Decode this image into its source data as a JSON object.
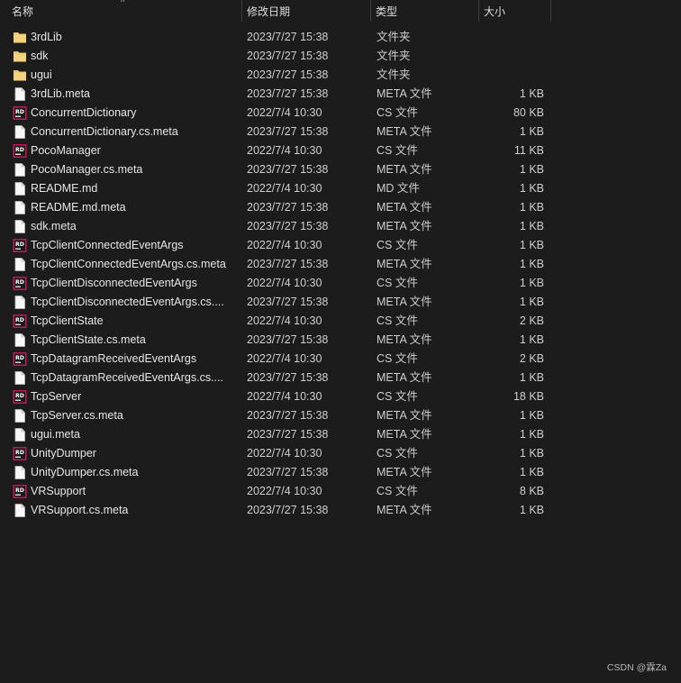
{
  "header": {
    "name": "名称",
    "date": "修改日期",
    "type": "类型",
    "size": "大小"
  },
  "colors": {
    "background": "#1c1c1c",
    "folder": "#e9c46a",
    "rider_icon_bg": "#1a1a1a",
    "rider_icon_border": "#c2185b"
  },
  "files": [
    {
      "icon": "folder-icon",
      "name": "3rdLib",
      "date": "2023/7/27 15:38",
      "type": "文件夹",
      "size": ""
    },
    {
      "icon": "folder-icon",
      "name": "sdk",
      "date": "2023/7/27 15:38",
      "type": "文件夹",
      "size": ""
    },
    {
      "icon": "folder-icon",
      "name": "ugui",
      "date": "2023/7/27 15:38",
      "type": "文件夹",
      "size": ""
    },
    {
      "icon": "file-icon",
      "name": "3rdLib.meta",
      "date": "2023/7/27 15:38",
      "type": "META 文件",
      "size": "1 KB"
    },
    {
      "icon": "rider-cs-icon",
      "name": "ConcurrentDictionary",
      "date": "2022/7/4 10:30",
      "type": "CS 文件",
      "size": "80 KB"
    },
    {
      "icon": "file-icon",
      "name": "ConcurrentDictionary.cs.meta",
      "date": "2023/7/27 15:38",
      "type": "META 文件",
      "size": "1 KB"
    },
    {
      "icon": "rider-cs-icon",
      "name": "PocoManager",
      "date": "2022/7/4 10:30",
      "type": "CS 文件",
      "size": "11 KB"
    },
    {
      "icon": "file-icon",
      "name": "PocoManager.cs.meta",
      "date": "2023/7/27 15:38",
      "type": "META 文件",
      "size": "1 KB"
    },
    {
      "icon": "file-icon",
      "name": "README.md",
      "date": "2022/7/4 10:30",
      "type": "MD 文件",
      "size": "1 KB"
    },
    {
      "icon": "file-icon",
      "name": "README.md.meta",
      "date": "2023/7/27 15:38",
      "type": "META 文件",
      "size": "1 KB"
    },
    {
      "icon": "file-icon",
      "name": "sdk.meta",
      "date": "2023/7/27 15:38",
      "type": "META 文件",
      "size": "1 KB"
    },
    {
      "icon": "rider-cs-icon",
      "name": "TcpClientConnectedEventArgs",
      "date": "2022/7/4 10:30",
      "type": "CS 文件",
      "size": "1 KB"
    },
    {
      "icon": "file-icon",
      "name": "TcpClientConnectedEventArgs.cs.meta",
      "date": "2023/7/27 15:38",
      "type": "META 文件",
      "size": "1 KB"
    },
    {
      "icon": "rider-cs-icon",
      "name": "TcpClientDisconnectedEventArgs",
      "date": "2022/7/4 10:30",
      "type": "CS 文件",
      "size": "1 KB"
    },
    {
      "icon": "file-icon",
      "name": "TcpClientDisconnectedEventArgs.cs....",
      "date": "2023/7/27 15:38",
      "type": "META 文件",
      "size": "1 KB"
    },
    {
      "icon": "rider-cs-icon",
      "name": "TcpClientState",
      "date": "2022/7/4 10:30",
      "type": "CS 文件",
      "size": "2 KB"
    },
    {
      "icon": "file-icon",
      "name": "TcpClientState.cs.meta",
      "date": "2023/7/27 15:38",
      "type": "META 文件",
      "size": "1 KB"
    },
    {
      "icon": "rider-cs-icon",
      "name": "TcpDatagramReceivedEventArgs",
      "date": "2022/7/4 10:30",
      "type": "CS 文件",
      "size": "2 KB"
    },
    {
      "icon": "file-icon",
      "name": "TcpDatagramReceivedEventArgs.cs....",
      "date": "2023/7/27 15:38",
      "type": "META 文件",
      "size": "1 KB"
    },
    {
      "icon": "rider-cs-icon",
      "name": "TcpServer",
      "date": "2022/7/4 10:30",
      "type": "CS 文件",
      "size": "18 KB"
    },
    {
      "icon": "file-icon",
      "name": "TcpServer.cs.meta",
      "date": "2023/7/27 15:38",
      "type": "META 文件",
      "size": "1 KB"
    },
    {
      "icon": "file-icon",
      "name": "ugui.meta",
      "date": "2023/7/27 15:38",
      "type": "META 文件",
      "size": "1 KB"
    },
    {
      "icon": "rider-cs-icon",
      "name": "UnityDumper",
      "date": "2022/7/4 10:30",
      "type": "CS 文件",
      "size": "1 KB"
    },
    {
      "icon": "file-icon",
      "name": "UnityDumper.cs.meta",
      "date": "2023/7/27 15:38",
      "type": "META 文件",
      "size": "1 KB"
    },
    {
      "icon": "rider-cs-icon",
      "name": "VRSupport",
      "date": "2022/7/4 10:30",
      "type": "CS 文件",
      "size": "8 KB"
    },
    {
      "icon": "file-icon",
      "name": "VRSupport.cs.meta",
      "date": "2023/7/27 15:38",
      "type": "META 文件",
      "size": "1 KB"
    }
  ],
  "watermark": "CSDN @霖Za"
}
